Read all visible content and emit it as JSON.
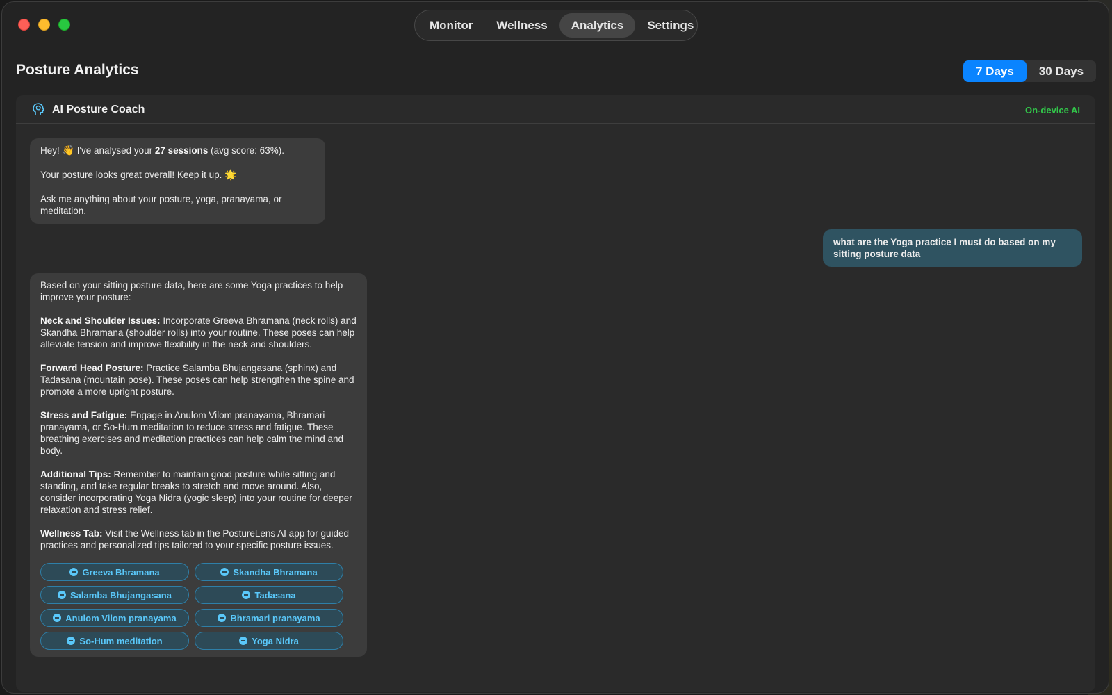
{
  "nav": {
    "tabs": [
      {
        "label": "Monitor"
      },
      {
        "label": "Wellness"
      },
      {
        "label": "Analytics",
        "active": true
      },
      {
        "label": "Settings"
      }
    ]
  },
  "header": {
    "title": "Posture Analytics",
    "range": {
      "options": [
        "7 Days",
        "30 Days"
      ],
      "selected": "7 Days"
    }
  },
  "coach": {
    "title": "AI Posture Coach",
    "badge": "On-device AI",
    "messages": [
      {
        "role": "assistant",
        "greeting_pre": "Hey! ",
        "greeting_emoji": "👋",
        "greeting_mid": " I've analysed your ",
        "sessions": "27 sessions",
        "greeting_post": " (avg score: 63%).",
        "line2": "Your posture looks great overall! Keep it up. ",
        "line2_emoji": "🌟",
        "line3": "Ask me anything about your posture, yoga, pranayama, or meditation."
      },
      {
        "role": "user",
        "text": "what are the Yoga practice I must do based on my sitting posture data"
      },
      {
        "role": "assistant",
        "intro": "Based on your sitting posture data, here are some Yoga practices to help improve your posture:",
        "sections": [
          {
            "heading": "Neck and Shoulder Issues:",
            "text": " Incorporate Greeva Bhramana (neck rolls) and Skandha Bhramana (shoulder rolls) into your routine. These poses can help alleviate tension and improve flexibility in the neck and shoulders."
          },
          {
            "heading": "Forward Head Posture:",
            "text": " Practice Salamba Bhujangasana (sphinx) and Tadasana (mountain pose). These poses can help strengthen the spine and promote a more upright posture."
          },
          {
            "heading": "Stress and Fatigue:",
            "text": " Engage in Anulom Vilom pranayama, Bhramari pranayama, or So-Hum meditation to reduce stress and fatigue. These breathing exercises and meditation practices can help calm the mind and body."
          },
          {
            "heading": "Additional Tips:",
            "text": " Remember to maintain good posture while sitting and standing, and take regular breaks to stretch and move around. Also, consider incorporating Yoga Nidra (yogic sleep) into your routine for deeper relaxation and stress relief."
          },
          {
            "heading": "Wellness Tab:",
            "text": " Visit the Wellness tab in the PostureLens AI app for guided practices and personalized tips tailored to your specific posture issues."
          }
        ],
        "chips": [
          "Greeva Bhramana",
          "Skandha Bhramana",
          "Salamba Bhujangasana",
          "Tadasana",
          "Anulom Vilom pranayama",
          "Bhramari pranayama",
          "So-Hum meditation",
          "Yoga Nidra"
        ]
      }
    ]
  },
  "colors": {
    "accent": "#0a84ff",
    "chip": "#5ac8fa",
    "badge": "#32c74a",
    "user_bubble": "#2f5361"
  }
}
